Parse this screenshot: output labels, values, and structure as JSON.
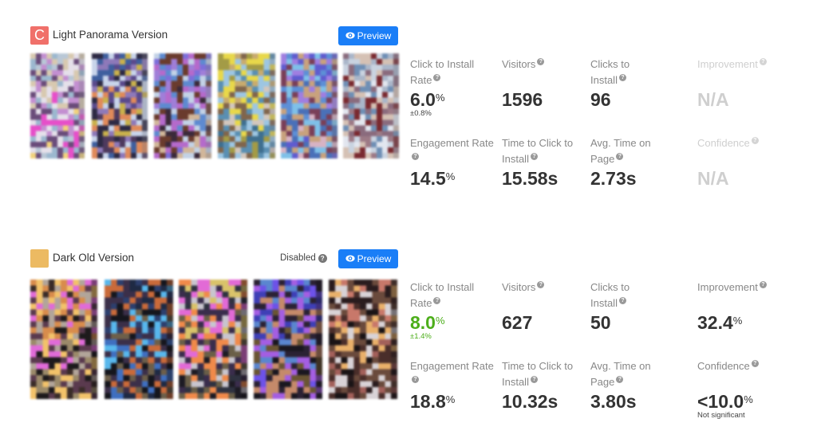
{
  "variants": [
    {
      "name": "Light Panorama Version",
      "badge_letter": "C",
      "badge_color": "#f0706a",
      "status_label": "",
      "preview_label": "Preview",
      "thumbnails": [
        {
          "name": "screenshot-1",
          "palette": [
            "#b9c7d6",
            "#d8c9b0",
            "#c38fd1",
            "#6a4c7a",
            "#e5e0ea",
            "#9cb8cf",
            "#e64fc9",
            "#f1d27c"
          ]
        },
        {
          "name": "screenshot-2",
          "palette": [
            "#3f5f9e",
            "#5a4a8c",
            "#c9b14c",
            "#2d2a44",
            "#8e79b9",
            "#c8d4ea",
            "#e08a5a",
            "#4e3a5e"
          ]
        },
        {
          "name": "screenshot-3",
          "palette": [
            "#7d6fd9",
            "#a07ed8",
            "#5e8ad0",
            "#6a3b2d",
            "#c3d2e6",
            "#b56acb",
            "#3b2a3a",
            "#d1b69a"
          ]
        },
        {
          "name": "screenshot-4",
          "palette": [
            "#a39b46",
            "#c8ab6e",
            "#e8d84a",
            "#5a8fb2",
            "#9dc6e2",
            "#80654c",
            "#d3c7bd",
            "#3f6f8f"
          ]
        },
        {
          "name": "screenshot-5",
          "palette": [
            "#5f5ccf",
            "#a07ee0",
            "#5d8fd6",
            "#7fc0e8",
            "#7a3f58",
            "#c8a27d",
            "#4a70b8",
            "#d7b3c4"
          ]
        },
        {
          "name": "screenshot-6",
          "palette": [
            "#c9d3e0",
            "#aab6c9",
            "#8a6b7d",
            "#d5c1b4",
            "#6f8fb5",
            "#7a2a30",
            "#e2e6ef",
            "#9d7a86"
          ]
        }
      ],
      "metrics": {
        "click_to_install_rate": {
          "label": "Click to Install Rate",
          "value": "6.0",
          "unit": "%",
          "sub": "±0.8%"
        },
        "visitors": {
          "label": "Visitors",
          "value": "1596"
        },
        "clicks_to_install": {
          "label": "Clicks to Install",
          "value": "96"
        },
        "improvement": {
          "label": "Improvement",
          "value": "N/A"
        },
        "engagement_rate": {
          "label": "Engagement Rate",
          "value": "14.5",
          "unit": "%"
        },
        "time_to_click": {
          "label": "Time to Click to Install",
          "value": "15.58s"
        },
        "avg_time": {
          "label": "Avg. Time on Page",
          "value": "2.73s"
        },
        "confidence": {
          "label": "Confidence",
          "value": "N/A",
          "sub": ""
        }
      }
    },
    {
      "name": "Dark Old Version",
      "badge_letter": "",
      "badge_color": "#ecba62",
      "status_label": "Disabled",
      "preview_label": "Preview",
      "thumbnails": [
        {
          "name": "screenshot-1",
          "palette": [
            "#3a2c28",
            "#d88c4c",
            "#e06bd8",
            "#b2a59a",
            "#f2c26a",
            "#5a3a4e",
            "#1d1a1c",
            "#9b8a6a"
          ]
        },
        {
          "name": "screenshot-2",
          "palette": [
            "#1f2a44",
            "#2d3f6e",
            "#58b7ec",
            "#c96a3a",
            "#3b2f49",
            "#15161d",
            "#6d5f4a",
            "#3f6fc0"
          ]
        },
        {
          "name": "screenshot-3",
          "palette": [
            "#2f3240",
            "#d9c36a",
            "#e26ad6",
            "#f08a4a",
            "#c8c5ce",
            "#3a2d4c",
            "#6a5f48",
            "#1d1b24"
          ]
        },
        {
          "name": "screenshot-4",
          "palette": [
            "#6d52e8",
            "#3f3fb6",
            "#5a86cf",
            "#a45ee2",
            "#2b2234",
            "#c58a6a",
            "#6a5533",
            "#1a1720"
          ]
        },
        {
          "name": "screenshot-5",
          "palette": [
            "#2a1c1e",
            "#c8786a",
            "#e9b06a",
            "#4a2e2a",
            "#6a4a3c",
            "#d8d2d6",
            "#1a1416",
            "#a3605a"
          ]
        }
      ],
      "metrics": {
        "click_to_install_rate": {
          "label": "Click to Install Rate",
          "value": "8.0",
          "unit": "%",
          "sub": "±1.4%"
        },
        "visitors": {
          "label": "Visitors",
          "value": "627"
        },
        "clicks_to_install": {
          "label": "Clicks to Install",
          "value": "50"
        },
        "improvement": {
          "label": "Improvement",
          "value": "32.4",
          "unit": "%"
        },
        "engagement_rate": {
          "label": "Engagement Rate",
          "value": "18.8",
          "unit": "%"
        },
        "time_to_click": {
          "label": "Time to Click to Install",
          "value": "10.32s"
        },
        "avg_time": {
          "label": "Avg. Time on Page",
          "value": "3.80s"
        },
        "confidence": {
          "label": "Confidence",
          "value": "<10.0",
          "unit": "%",
          "sub": "Not significant"
        }
      }
    }
  ],
  "colors": {
    "accent": "#1a7ef7",
    "positive": "#4cae1a",
    "muted": "#cfcfcf"
  },
  "icons": {
    "preview": "eye-icon",
    "help": "question-circle-icon"
  }
}
